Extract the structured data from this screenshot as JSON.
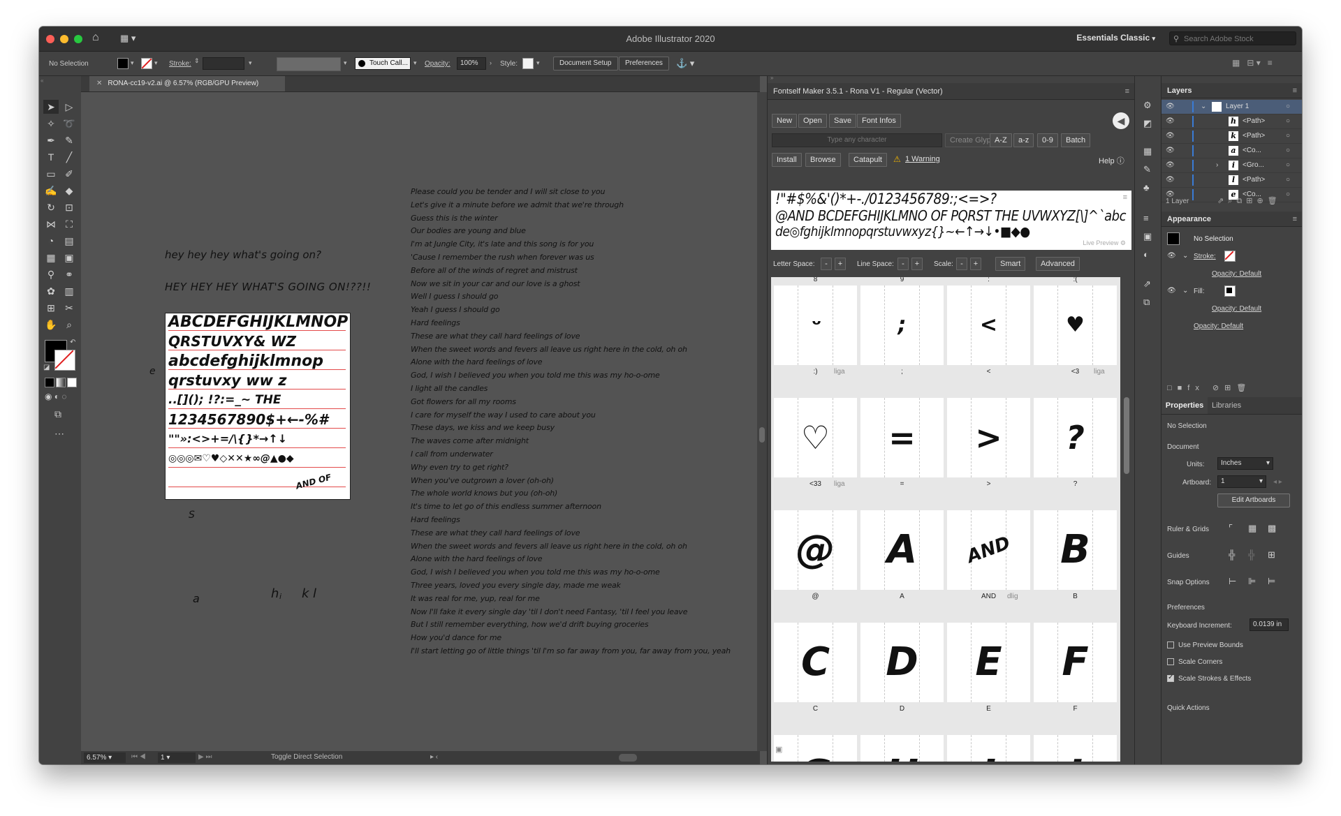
{
  "app": {
    "title": "Adobe Illustrator 2020",
    "workspace": "Essentials Classic",
    "search_placeholder": "Search Adobe Stock"
  },
  "control_bar": {
    "selection": "No Selection",
    "stroke_label": "Stroke:",
    "brush": "Touch Call...",
    "opacity_label": "Opacity:",
    "opacity_value": "100%",
    "style_label": "Style:",
    "document_setup": "Document Setup",
    "preferences": "Preferences"
  },
  "document": {
    "tab": "RONA-cc19-v2.ai @ 6.57% (RGB/GPU Preview)",
    "zoom": "6.57%",
    "artboard_number": "1",
    "status": "Toggle Direct Selection"
  },
  "canvas": {
    "text1": "hey hey hey what's going on?",
    "text2": "HEY HEY HEY WHAT'S GOING ON!??!!",
    "stray": [
      "e",
      "S",
      "a",
      "h",
      "i",
      "k",
      "l"
    ],
    "artboard_rows": [
      "ABCDEFGHIJKLMNOP",
      "QRSTUVXY&     WZ",
      "abcdefghijklmnop",
      "qrstuvxy  ww   z",
      "..[](); !?:=_~ THE",
      "1234567890$+←-%#",
      "\"\"»:<>+=/\\{}*→↑↓",
      "◎◎◎✉♡♥◇✕✕★∞@▲●◆",
      "AND OF"
    ],
    "lyrics": [
      "Please could you be tender and I will sit close to you",
      "Let's give it a minute before we admit that we're through",
      "Guess this is the winter",
      "Our bodies are young and blue",
      "I'm at Jungle City, it's late and this song is for you",
      "'Cause I remember the rush when forever was us",
      "Before all of the winds of regret and mistrust",
      "Now we sit in your car and our love is a ghost",
      "Well I guess I should go",
      "Yeah I guess I should go",
      "Hard feelings",
      "These are what they call hard feelings of love",
      "When the sweet words and fevers all leave us right here in the cold, oh oh",
      "Alone with the hard feelings of love",
      "God, I wish I believed you when you told me this was my ho-o-ome",
      "I light all the candles",
      "Got flowers for all my rooms",
      "I care for myself the way I used to care about you",
      "These days, we kiss and we keep busy",
      "The waves come after midnight",
      "I call from underwater",
      "Why even try to get right?",
      "When you've outgrown a lover (oh-oh)",
      "The whole world knows but you (oh-oh)",
      "It's time to let go of this endless summer afternoon",
      "Hard feelings",
      "These are what they call hard feelings of love",
      "When the sweet words and fevers all leave us right here in the cold, oh oh",
      "Alone with the hard feelings of love",
      "God, I wish I believed you when you told me this was my ho-o-ome",
      "Three years, loved you every single day, made me weak",
      "It was real for me, yup, real for me",
      "Now I'll fake it every single day 'til I don't need Fantasy, 'til I feel you leave",
      "But I still remember everything, how we'd drift buying groceries",
      "How you'd dance for me",
      "I'll start letting go of little things 'til I'm so far away from you, far away from you, yeah"
    ]
  },
  "fontself": {
    "title": "Fontself Maker 3.5.1 - Rona V1 - Regular (Vector)",
    "buttons_row1": [
      "New",
      "Open",
      "Save",
      "Font Infos"
    ],
    "char_placeholder": "Type any character",
    "create_glyph": "Create Glyph",
    "range_buttons": [
      "A-Z",
      "a-z",
      "0-9",
      "Batch"
    ],
    "buttons_row3": [
      "Install",
      "Browse",
      "Catapult"
    ],
    "warning": "1 Warning",
    "help": "Help",
    "preview_lines": [
      "!\"#$%&'()*+-./0123456789:;<=>?",
      "@AND BCDEFGHIJKLMNO OF PQRST THE UVWXYZ[\\]^`abc",
      "de◎fghijklmnopqrstuvwxyz{}~←↑→↓•■◆●"
    ],
    "live_preview": "Live Preview",
    "letter_space": "Letter Space:",
    "line_space": "Line Space:",
    "scale": "Scale:",
    "smart": "Smart",
    "advanced": "Advanced",
    "top_labels": [
      "8",
      "9",
      ":",
      ":("
    ],
    "glyph_rows": [
      {
        "glyphs": [
          "ᵕ",
          ";",
          "<",
          "♥"
        ],
        "labels": [
          ":)",
          ";",
          "<",
          "<3"
        ],
        "ligas": [
          "liga",
          "",
          "",
          "liga"
        ]
      },
      {
        "glyphs": [
          "♡",
          "=",
          ">",
          "?"
        ],
        "labels": [
          "<33",
          "=",
          ">",
          "?"
        ],
        "ligas": [
          "liga",
          "",
          "",
          ""
        ]
      },
      {
        "glyphs": [
          "@",
          "A",
          "AND",
          "B"
        ],
        "labels": [
          "@",
          "A",
          "AND",
          "B"
        ],
        "ligas": [
          "",
          "",
          "dlig",
          ""
        ]
      },
      {
        "glyphs": [
          "C",
          "D",
          "E",
          "F"
        ],
        "labels": [
          "C",
          "D",
          "E",
          "F"
        ],
        "ligas": [
          "",
          "",
          "",
          ""
        ]
      },
      {
        "glyphs": [
          "G",
          "H",
          "I",
          "J"
        ],
        "labels": [
          "",
          "",
          "",
          ""
        ],
        "ligas": [
          "",
          "",
          "",
          ""
        ]
      }
    ]
  },
  "layers": {
    "title": "Layers",
    "rows": [
      {
        "name": "Layer 1",
        "thumb": ""
      },
      {
        "name": "<Path>",
        "thumb": "h"
      },
      {
        "name": "<Path>",
        "thumb": "k"
      },
      {
        "name": "<Co...",
        "thumb": "a"
      },
      {
        "name": "<Gro...",
        "thumb": "i"
      },
      {
        "name": "<Path>",
        "thumb": "l"
      },
      {
        "name": "<Co...",
        "thumb": "e"
      }
    ],
    "count": "1 Layer"
  },
  "appearance": {
    "title": "Appearance",
    "no_selection": "No Selection",
    "stroke": "Stroke:",
    "stroke_opacity": "Opacity: Default",
    "fill": "Fill:",
    "fill_opacity": "Opacity: Default",
    "opacity": "Opacity: Default"
  },
  "properties": {
    "tab1": "Properties",
    "tab2": "Libraries",
    "no_selection": "No Selection",
    "document": "Document",
    "units_label": "Units:",
    "units_value": "Inches",
    "artboard_label": "Artboard:",
    "artboard_value": "1",
    "edit_artboards": "Edit Artboards",
    "ruler_grids": "Ruler & Grids",
    "guides": "Guides",
    "snap_options": "Snap Options",
    "preferences": "Preferences",
    "keyboard_increment": "Keyboard Increment:",
    "keyboard_increment_value": "0.0139 in",
    "use_preview_bounds": "Use Preview Bounds",
    "scale_corners": "Scale Corners",
    "scale_strokes": "Scale Strokes & Effects",
    "quick_actions": "Quick Actions"
  }
}
